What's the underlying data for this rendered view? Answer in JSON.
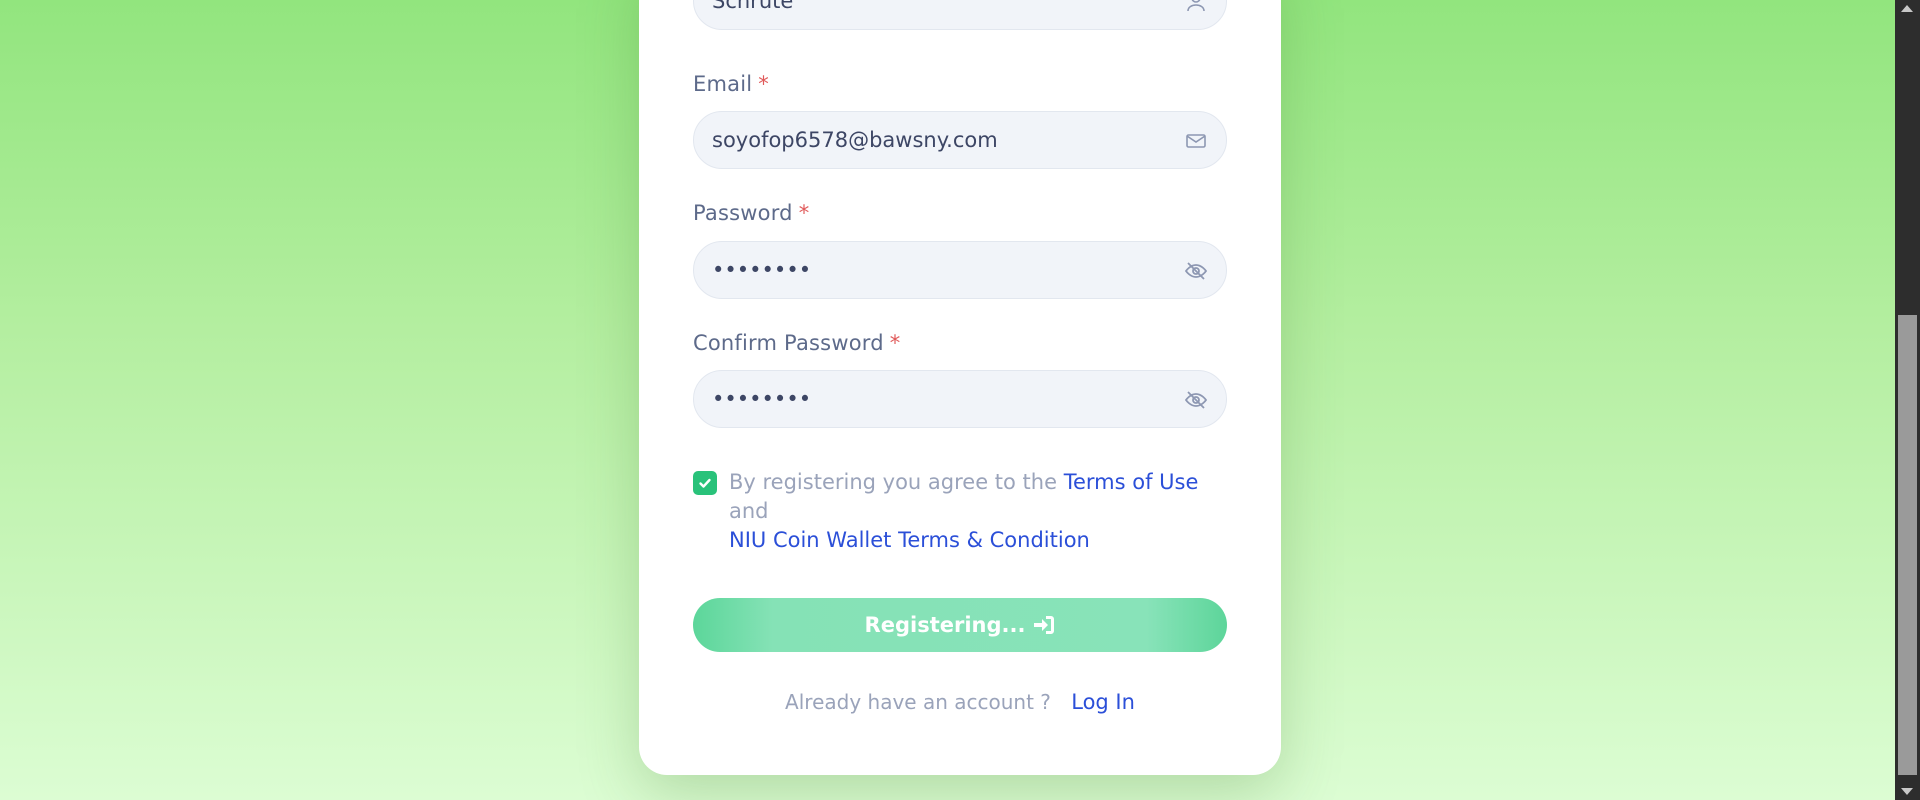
{
  "form": {
    "last_name_value": "Schrute",
    "email": {
      "label": "Email",
      "required_mark": "*",
      "value": "soyofop6578@bawsny.com"
    },
    "password": {
      "label": "Password",
      "required_mark": "*",
      "value": "••••••••"
    },
    "confirm_password": {
      "label": "Confirm Password",
      "required_mark": "*",
      "value": "••••••••"
    },
    "terms": {
      "checked": true,
      "prefix": "By registering you agree to the",
      "terms_link": "Terms of Use",
      "middle": "and",
      "wallet_link": "NIU Coin Wallet Terms & Condition"
    },
    "submit_label": "Registering...",
    "login_prompt": "Already have an account ?",
    "login_link": "Log In"
  },
  "colors": {
    "accent_green": "#29c27a",
    "link_blue": "#2b4fd8",
    "required_red": "#e05a5a"
  },
  "icons": {
    "last_name": "user-icon",
    "email": "mail-icon",
    "password": "eye-off-icon",
    "confirm_password": "eye-off-icon",
    "submit": "sign-in-icon",
    "checkbox": "check-icon"
  }
}
